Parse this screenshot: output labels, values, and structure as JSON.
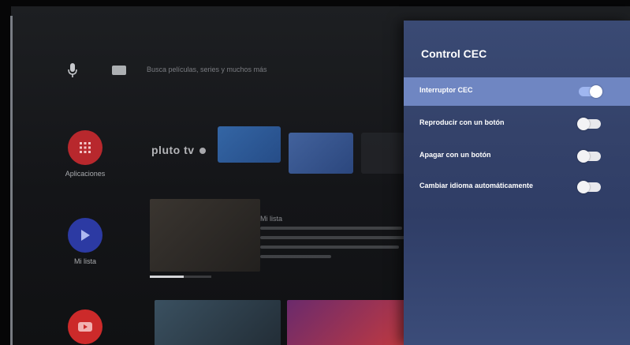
{
  "search": {
    "hint": "Busca películas, series y muchos más"
  },
  "nav": {
    "items": [
      {
        "label": "Aplicaciones",
        "icon": "apps-grid-icon",
        "color": "#c0272d"
      },
      {
        "label": "Mi lista",
        "icon": "play-icon",
        "color": "#2f3ea8"
      },
      {
        "label": "",
        "icon": "youtube-icon",
        "color": "#d42a2a"
      }
    ]
  },
  "channels": {
    "pluto": "pluto tv"
  },
  "content": {
    "desc_title": "Mi lista"
  },
  "panel": {
    "title": "Control CEC",
    "rows": [
      {
        "label": "Interruptor CEC",
        "state": "on",
        "selected": true
      },
      {
        "label": "Reproducir con un botón",
        "state": "off",
        "selected": false
      },
      {
        "label": "Apagar con un botón",
        "state": "off",
        "selected": false
      },
      {
        "label": "Cambiar idioma automáticamente",
        "state": "off",
        "selected": false
      }
    ]
  },
  "colors": {
    "panel": "#34426a",
    "selected_row": "#6f86c2",
    "toggle_on": "#9fb6f0"
  }
}
